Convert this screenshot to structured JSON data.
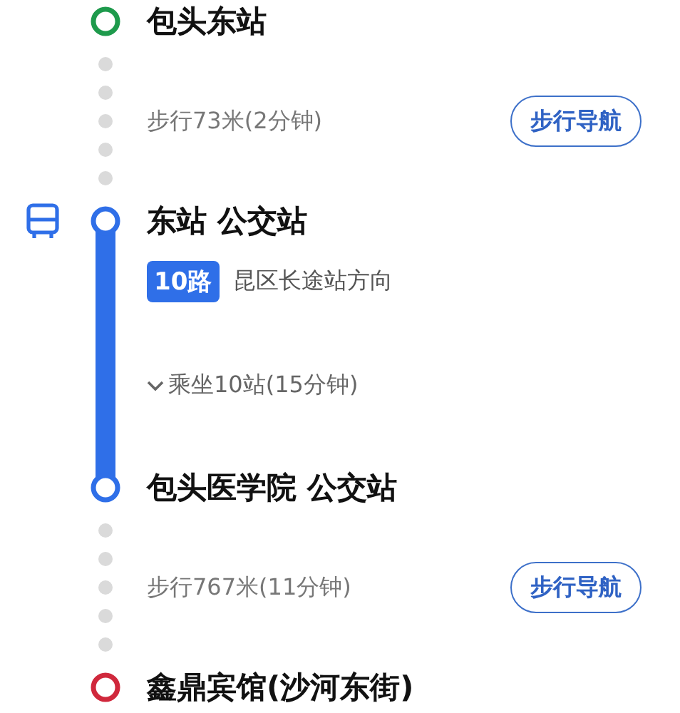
{
  "steps": [
    {
      "kind": "station",
      "name": "包头东站",
      "color": "#1e9a4c",
      "boarding": false
    },
    {
      "kind": "walk",
      "summary": "步行73米(2分钟)",
      "button": "步行导航"
    },
    {
      "kind": "station",
      "name": "东站 公交站",
      "color": "#2f6fe8",
      "boarding": true
    },
    {
      "kind": "bus",
      "route": "10路",
      "direction": "昆区长途站方向",
      "ride": "乘坐10站(15分钟)",
      "expanded": false,
      "color": "#2f6fe8"
    },
    {
      "kind": "station",
      "name": "包头医学院 公交站",
      "color": "#2f6fe8",
      "boarding": false
    },
    {
      "kind": "walk",
      "summary": "步行767米(11分钟)",
      "button": "步行导航"
    },
    {
      "kind": "station",
      "name": "鑫鼎宾馆(沙河东街)",
      "color": "#d0283c",
      "boarding": false
    }
  ]
}
